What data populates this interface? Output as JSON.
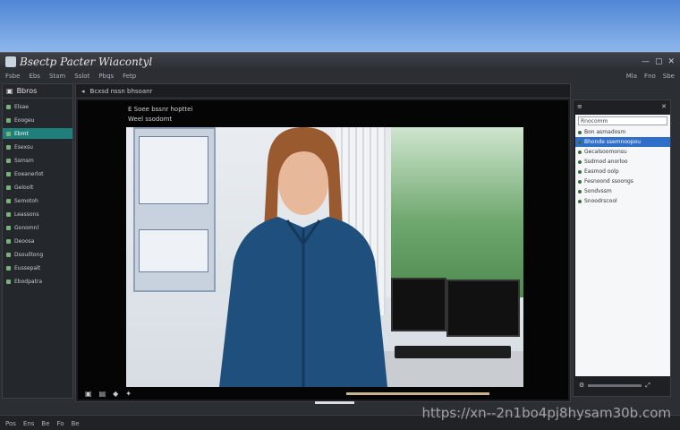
{
  "window": {
    "title": "Bsectp Pacter Wiacontyl",
    "controls": [
      "—",
      "▢",
      "✕"
    ]
  },
  "menubar": {
    "items": [
      "Fsbe",
      "Ebs",
      "Stam",
      "Sslot",
      "Pbqs",
      "Fetp"
    ],
    "right": [
      "Mla",
      "Fno",
      "Sbe"
    ]
  },
  "sidebar": {
    "header": "Bbros",
    "items": [
      {
        "label": "Elsae",
        "active": false
      },
      {
        "label": "Eoogeu",
        "active": false
      },
      {
        "label": "Ebmt",
        "active": true
      },
      {
        "label": "Esexsu",
        "active": false
      },
      {
        "label": "Ssmsm",
        "active": false
      },
      {
        "label": "Eoeanerlot",
        "active": false
      },
      {
        "label": "Geloolt",
        "active": false
      },
      {
        "label": "Semotoh",
        "active": false
      },
      {
        "label": "Leassons",
        "active": false
      },
      {
        "label": "Gonomnl",
        "active": false
      },
      {
        "label": "Deoosa",
        "active": false
      },
      {
        "label": "Dsouiltong",
        "active": false
      },
      {
        "label": "Eussepalt",
        "active": false
      },
      {
        "label": "Ebodpatra",
        "active": false
      }
    ]
  },
  "center": {
    "toolbar_label": "Bcxsd nssn bhsoanr",
    "viewer_label": "E Soee bssnr hopttei",
    "viewer_label2": "Weel ssodomt"
  },
  "rightpanel": {
    "input_text": "Rnocomm",
    "rows": [
      {
        "label": "Bon asmadosm",
        "selected": false
      },
      {
        "label": "Bhonde ssemnoopou",
        "selected": true
      },
      {
        "label": "Gecalsoomonsu",
        "selected": false
      },
      {
        "label": "Ssdmod anorloo",
        "selected": false
      },
      {
        "label": "Easmod oolp",
        "selected": false
      },
      {
        "label": "Fesnoond ssoongs",
        "selected": false
      },
      {
        "label": "Sondvssm",
        "selected": false
      },
      {
        "label": "Snoodrscool",
        "selected": false
      }
    ]
  },
  "statusbar": {
    "items": [
      "Pos",
      "Ens",
      "Be",
      "Fo",
      "Be"
    ]
  },
  "watermark": "https://xn--2n1bo4pj8hysam30b.com"
}
